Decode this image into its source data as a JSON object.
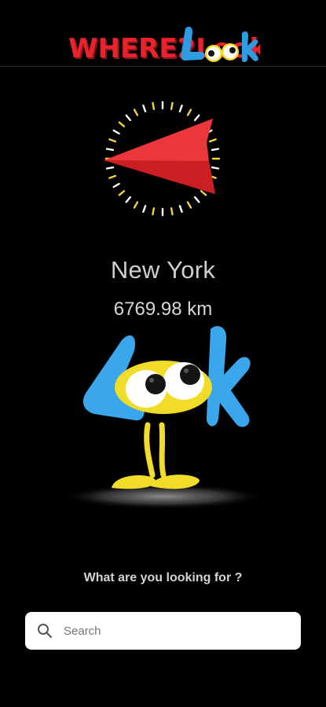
{
  "app": {
    "logo_text": "WHERE2Look"
  },
  "destination": {
    "city": "New York",
    "distance": "6769.98 km"
  },
  "search": {
    "prompt": "What are you looking for ?",
    "placeholder": "Search",
    "value": ""
  },
  "colors": {
    "background": "#000000",
    "logo_red": "#e8232b",
    "logo_blue": "#2f9be0",
    "arrow_red": "#e5252a",
    "compass_ticks": "#f1d53a",
    "mascot_blue": "#3aa6ec",
    "mascot_yellow": "#f2dc2a"
  },
  "icons": {
    "compass": "compass-arrow-icon",
    "search": "search-icon"
  }
}
